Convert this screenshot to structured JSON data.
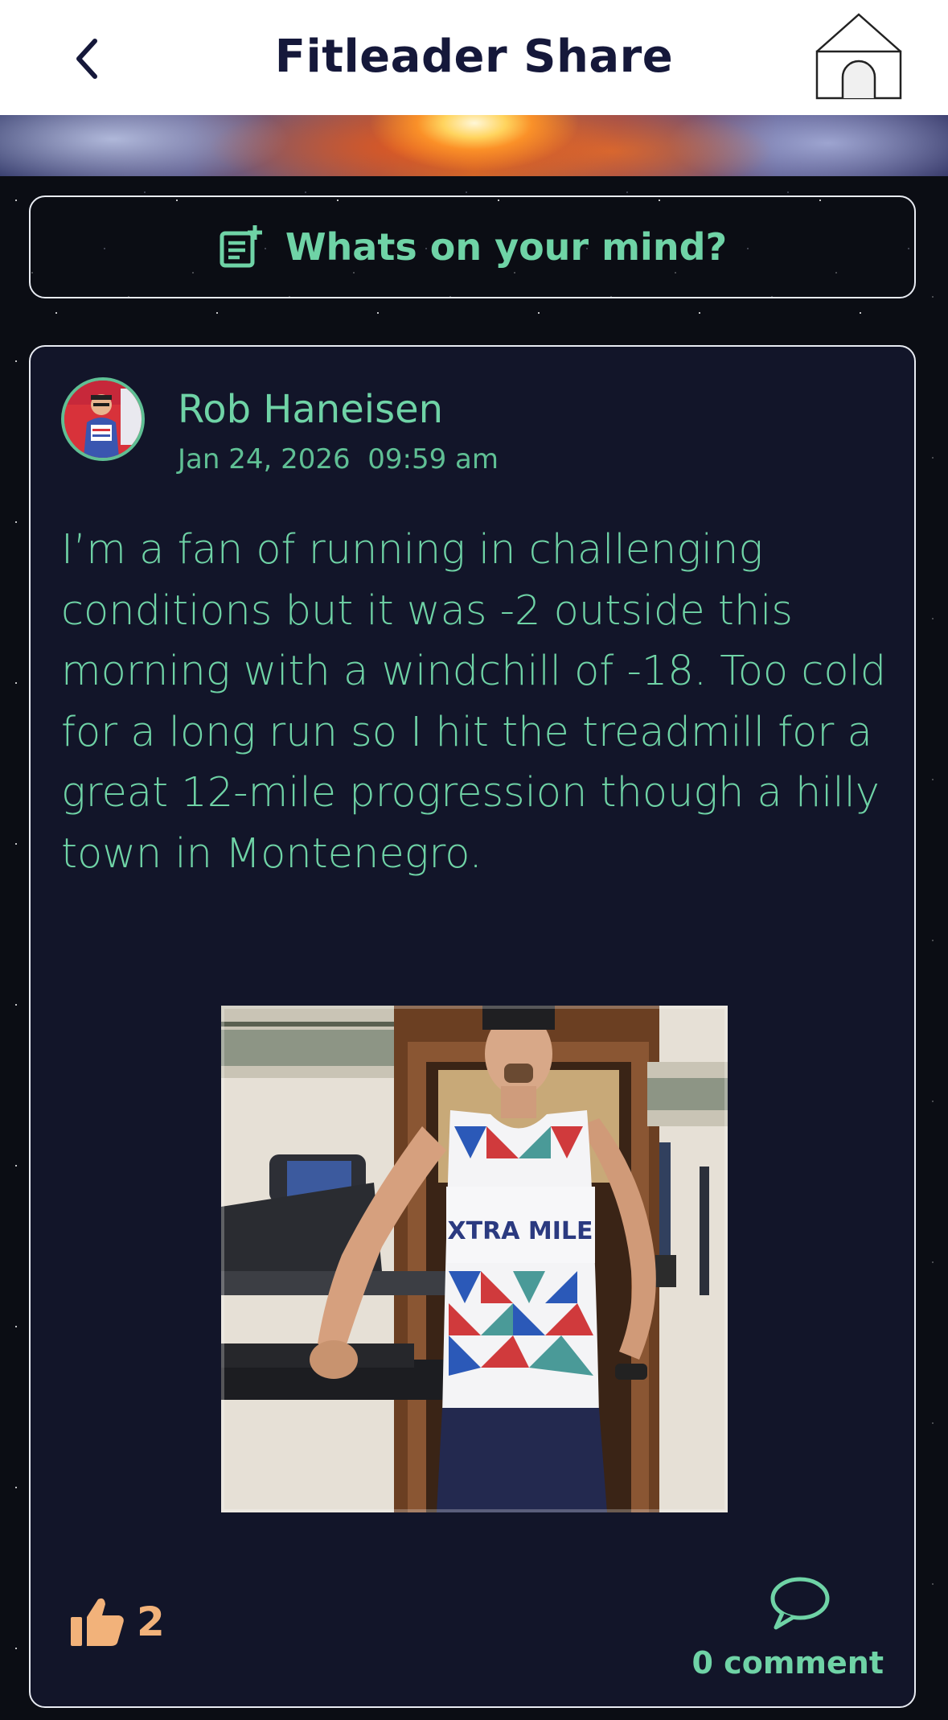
{
  "header": {
    "title": "Fitleader Share",
    "back_icon": "chevron-left-icon",
    "home_icon": "home-icon"
  },
  "composer": {
    "placeholder": "Whats on your mind?",
    "icon": "new-post-icon"
  },
  "post": {
    "author": "Rob Haneisen",
    "date": "Jan 24, 2026  09:59 am",
    "text": "I’m a fan of running in challenging conditions but it was -2 outside this morning with a windchill of -18. Too cold for a long run so I hit the treadmill for a great 12-mile progression though a hilly town in Montenegro.",
    "photo_shirt_text": "XTRA MILE",
    "likes": "2",
    "comments_label": "0 comment",
    "like_icon": "thumbs-up-icon",
    "comment_icon": "comment-bubble-icon"
  },
  "colors": {
    "accent_green": "#6fd3a6",
    "like_orange": "#f2b27a",
    "card_bg": "#121529",
    "title_navy": "#15183a"
  }
}
